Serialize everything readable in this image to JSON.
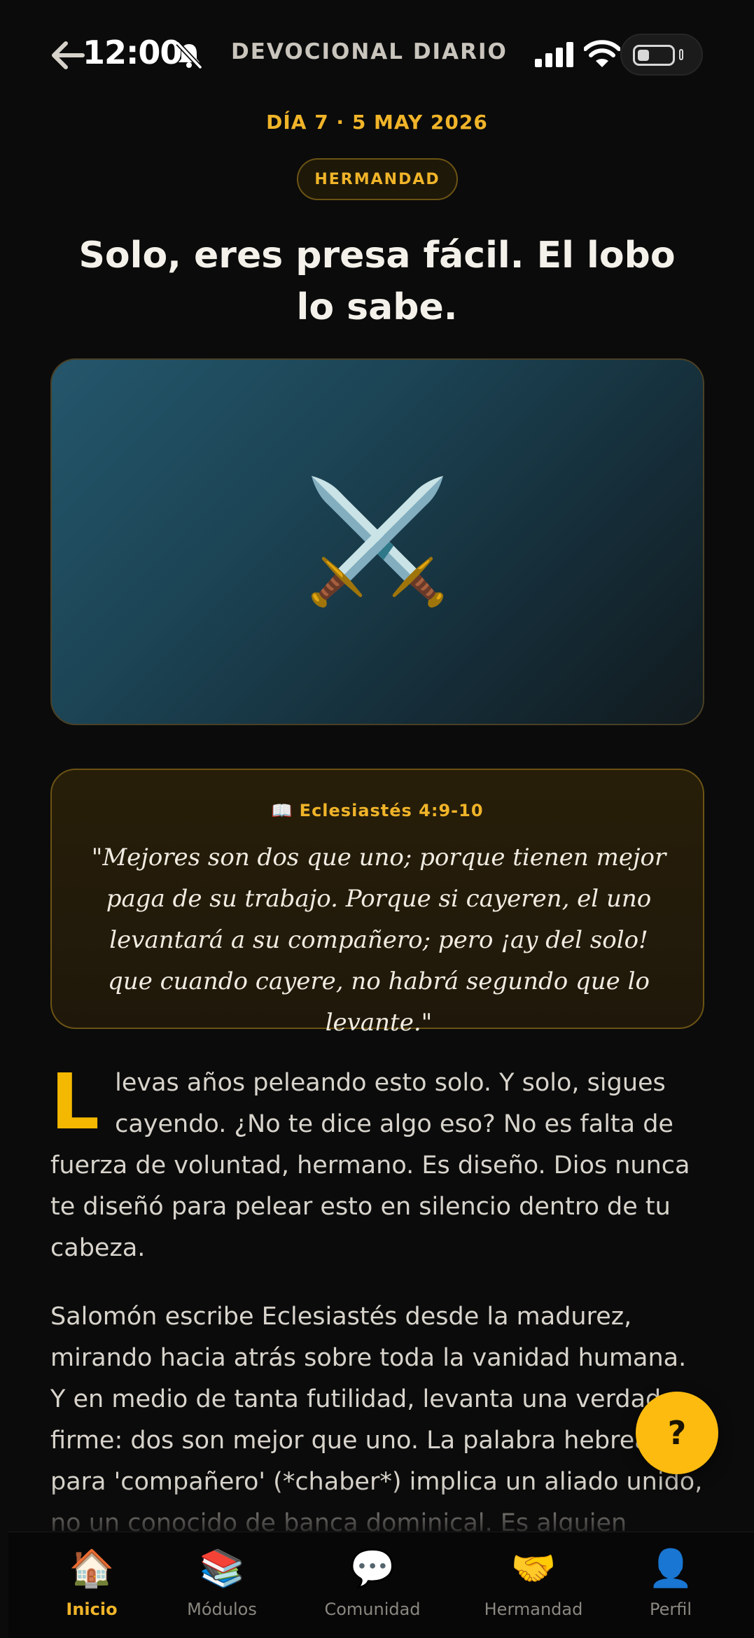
{
  "header": {
    "time": "12:00",
    "title": "DEVOCIONAL DIARIO"
  },
  "devotional": {
    "day_line": "DÍA 7 · 5 MAY 2026",
    "category": "HERMANDAD",
    "title": "Solo, eres presa fácil. El lobo lo sabe.",
    "hero_icon": "⚔️",
    "verse": {
      "reference": "📖 Eclesiastés 4:9-10",
      "text": "\"Mejores son dos que uno; porque tienen mejor paga de su trabajo. Porque si cayeren, el uno levantará a su compañero; pero ¡ay del solo! que cuando cayere, no habrá segundo que lo levante.\""
    },
    "body": {
      "drop_cap": "L",
      "paragraph_1": "levas años peleando esto solo. Y solo, sigues cayendo. ¿No te dice algo eso? No es falta de fuerza de voluntad, hermano. Es diseño. Dios nunca te diseñó para pelear esto en silencio dentro de tu cabeza.",
      "paragraph_2": "Salomón escribe Eclesiastés desde la madurez, mirando hacia atrás sobre toda la vanidad humana. Y en medio de tanta futilidad, levanta una verdad firme: dos son mejor que uno. La palabra hebrea para 'compañero' (*chaber*) implica un aliado unido, no un conocido de banca dominical. Es alguien atado a tu"
    }
  },
  "help_button": {
    "label": "?"
  },
  "accent_color": "#f0b429",
  "bottom_nav": {
    "items": [
      {
        "label": "Inicio",
        "icon": "🏠",
        "icon_name": "home-icon",
        "active": true
      },
      {
        "label": "Módulos",
        "icon": "📚",
        "icon_name": "books-icon",
        "active": false
      },
      {
        "label": "Comunidad",
        "icon": "💬",
        "icon_name": "chat-bubble-icon",
        "active": false
      },
      {
        "label": "Hermandad",
        "icon": "🤝",
        "icon_name": "handshake-icon",
        "active": false
      },
      {
        "label": "Perfil",
        "icon": "👤",
        "icon_name": "profile-icon",
        "active": false
      }
    ]
  }
}
